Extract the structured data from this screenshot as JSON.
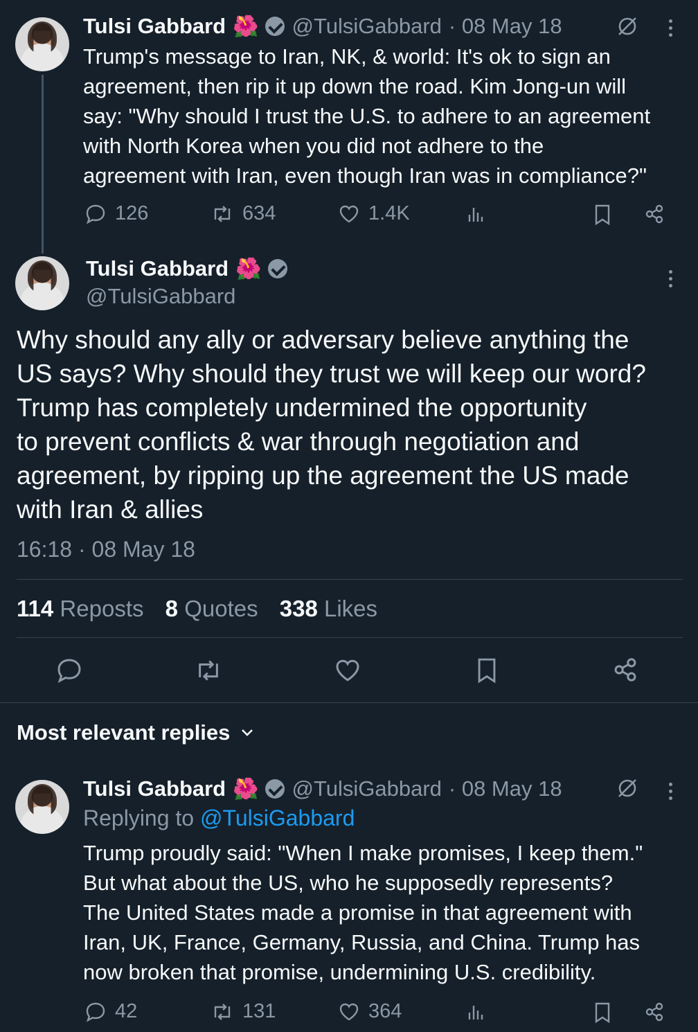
{
  "tweet1": {
    "name": "Tulsi Gabbard",
    "flower": "🌺",
    "handle": "@TulsiGabbard",
    "date": "· 08 May 18",
    "lines": [
      "Trump's message to Iran, NK, & world: It's ok to sign an",
      "agreement, then rip it up down the road. Kim Jong-un will",
      "say: \"Why should I trust the U.S. to adhere to an agreement",
      "with North Korea when you did not adhere to the",
      "agreement with Iran, even though Iran was in compliance?\""
    ],
    "replies": "126",
    "reposts": "634",
    "likes": "1.4K"
  },
  "main": {
    "name": "Tulsi Gabbard",
    "flower": "🌺",
    "handle": "@TulsiGabbard",
    "lines": [
      "Why should any ally or adversary believe anything the",
      "US says? Why should they trust we will keep our word?",
      "Trump has completely undermined the opportunity",
      "to prevent conflicts & war through negotiation and",
      "agreement, by ripping up the agreement the US made",
      "with Iran & allies"
    ],
    "timestamp": "16:18 · 08 May 18",
    "reposts_count": "114",
    "reposts_label": "Reposts",
    "quotes_count": "8",
    "quotes_label": "Quotes",
    "likes_count": "338",
    "likes_label": "Likes"
  },
  "replies_section": {
    "title": "Most relevant replies"
  },
  "reply1": {
    "name": "Tulsi Gabbard",
    "flower": "🌺",
    "handle": "@TulsiGabbard",
    "date": "· 08 May 18",
    "replying_prefix": "Replying to",
    "replying_to": "@TulsiGabbard",
    "lines": [
      "Trump proudly said: \"When I make promises, I keep them.\"",
      "But what about the US, who he supposedly represents?",
      "The United States made a promise in that agreement with",
      "Iran, UK, France, Germany, Russia, and China. Trump has",
      "now broken that promise, undermining U.S. credibility."
    ],
    "replies": "42",
    "reposts": "131",
    "likes": "364"
  },
  "icons": {
    "reply": "reply-icon",
    "repost": "repost-icon",
    "like": "heart-icon",
    "views": "views-icon",
    "bookmark": "bookmark-icon",
    "share": "share-icon",
    "grok": "grok-icon",
    "more": "more-icon",
    "verified": "verified-badge-icon",
    "chevron": "chevron-down-icon"
  },
  "colors": {
    "background": "#15202b",
    "text": "#f7f9f9",
    "muted": "#8b98a5",
    "link": "#1d9bf0",
    "divider": "#38444d"
  }
}
